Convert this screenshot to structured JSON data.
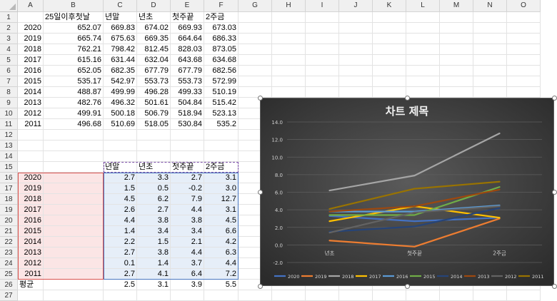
{
  "columns": [
    "A",
    "B",
    "C",
    "D",
    "E",
    "F",
    "G",
    "H",
    "I",
    "J",
    "K",
    "L",
    "M",
    "N",
    "O"
  ],
  "rows": [
    "1",
    "2",
    "3",
    "4",
    "5",
    "6",
    "7",
    "8",
    "9",
    "10",
    "11",
    "12",
    "13",
    "14",
    "15",
    "16",
    "17",
    "18",
    "19",
    "20",
    "21",
    "22",
    "23",
    "24",
    "25",
    "26",
    "27"
  ],
  "top_table": {
    "header": [
      "",
      "25일이후첫날",
      "년말",
      "년초",
      "첫주끝",
      "2주금"
    ],
    "rows": [
      [
        "2020",
        "652.07",
        "669.83",
        "674.02",
        "669.93",
        "673.03"
      ],
      [
        "2019",
        "665.74",
        "675.63",
        "669.35",
        "664.64",
        "686.33"
      ],
      [
        "2018",
        "762.21",
        "798.42",
        "812.45",
        "828.03",
        "873.05"
      ],
      [
        "2017",
        "615.16",
        "631.44",
        "632.04",
        "643.68",
        "634.68"
      ],
      [
        "2016",
        "652.05",
        "682.35",
        "677.79",
        "677.79",
        "682.56"
      ],
      [
        "2015",
        "535.17",
        "542.97",
        "553.73",
        "553.73",
        "572.99"
      ],
      [
        "2014",
        "488.87",
        "499.99",
        "496.28",
        "499.33",
        "510.19"
      ],
      [
        "2013",
        "482.76",
        "496.32",
        "501.61",
        "504.84",
        "515.42"
      ],
      [
        "2012",
        "499.91",
        "500.18",
        "506.79",
        "518.94",
        "523.13"
      ],
      [
        "2011",
        "496.68",
        "510.69",
        "518.05",
        "530.84",
        "535.2"
      ]
    ]
  },
  "bottom_table": {
    "header": [
      "",
      "",
      "년말",
      "년초",
      "첫주끝",
      "2주금"
    ],
    "rows": [
      [
        "2020",
        "",
        "2.7",
        "3.3",
        "2.7",
        "3.1"
      ],
      [
        "2019",
        "",
        "1.5",
        "0.5",
        "-0.2",
        "3.0"
      ],
      [
        "2018",
        "",
        "4.5",
        "6.2",
        "7.9",
        "12.7"
      ],
      [
        "2017",
        "",
        "2.6",
        "2.7",
        "4.4",
        "3.1"
      ],
      [
        "2016",
        "",
        "4.4",
        "3.8",
        "3.8",
        "4.5"
      ],
      [
        "2015",
        "",
        "1.4",
        "3.4",
        "3.4",
        "6.6"
      ],
      [
        "2014",
        "",
        "2.2",
        "1.5",
        "2.1",
        "4.2"
      ],
      [
        "2013",
        "",
        "2.7",
        "3.8",
        "4.4",
        "6.3"
      ],
      [
        "2012",
        "",
        "0.1",
        "1.4",
        "3.7",
        "4.4"
      ],
      [
        "2011",
        "",
        "2.7",
        "4.1",
        "6.4",
        "7.2"
      ]
    ],
    "avg": [
      "평균",
      "",
      "2.5",
      "3.1",
      "3.9",
      "5.5"
    ]
  },
  "chart_data": {
    "type": "line",
    "title": "차트 제목",
    "categories": [
      "년초",
      "첫주끝",
      "2주금"
    ],
    "ylim": [
      -2.0,
      14.0
    ],
    "yticks": [
      "14.0",
      "12.0",
      "10.0",
      "8.0",
      "6.0",
      "4.0",
      "2.0",
      "0.0",
      "-2.0"
    ],
    "grid": true,
    "legend_position": "bottom",
    "series": [
      {
        "name": "2020",
        "color": "#4472c4",
        "values": [
          3.3,
          2.7,
          3.1
        ]
      },
      {
        "name": "2019",
        "color": "#ed7d31",
        "values": [
          0.5,
          -0.2,
          3.0
        ]
      },
      {
        "name": "2018",
        "color": "#a5a5a5",
        "values": [
          6.2,
          7.9,
          12.7
        ]
      },
      {
        "name": "2017",
        "color": "#ffc000",
        "values": [
          2.7,
          4.4,
          3.1
        ]
      },
      {
        "name": "2016",
        "color": "#5b9bd5",
        "values": [
          3.8,
          3.8,
          4.5
        ]
      },
      {
        "name": "2015",
        "color": "#70ad47",
        "values": [
          3.4,
          3.4,
          6.6
        ]
      },
      {
        "name": "2014",
        "color": "#264478",
        "values": [
          1.5,
          2.1,
          4.2
        ]
      },
      {
        "name": "2013",
        "color": "#9e480e",
        "values": [
          3.8,
          4.4,
          6.3
        ]
      },
      {
        "name": "2012",
        "color": "#636363",
        "values": [
          1.4,
          3.7,
          4.4
        ]
      },
      {
        "name": "2011",
        "color": "#997300",
        "values": [
          4.1,
          6.4,
          7.2
        ]
      }
    ]
  }
}
